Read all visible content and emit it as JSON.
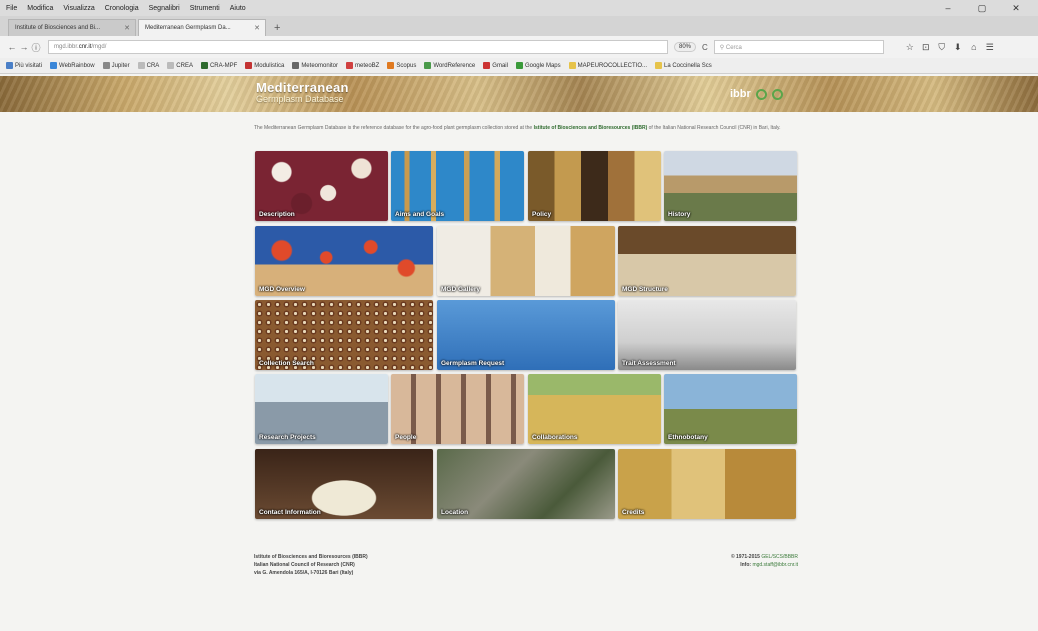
{
  "menu": {
    "items": [
      "File",
      "Modifica",
      "Visualizza",
      "Cronologia",
      "Segnalibri",
      "Strumenti",
      "Aiuto"
    ]
  },
  "window_controls": [
    "–",
    "▢",
    "✕"
  ],
  "tabs": [
    {
      "label": "Institute of Biosciences and Bi..."
    },
    {
      "label": "Mediterranean Germplasm Da..."
    }
  ],
  "newtab_label": "+",
  "nav": {
    "back": "←",
    "forward": "→",
    "info": "ⓘ",
    "url_prefix": "mgd.ibbr.",
    "url_domain": "cnr.it",
    "url_suffix": "/mgd/",
    "zoom": "80%",
    "reload": "C",
    "search_placeholder": "Cerca"
  },
  "toolbar_icons": [
    "☆",
    "⊡",
    "⛉",
    "⬇",
    "⌂",
    "☰"
  ],
  "bookmarks": [
    {
      "label": "Più visitati",
      "color": "#4a7fc7"
    },
    {
      "label": "WebRainbow",
      "color": "#3a86d8"
    },
    {
      "label": "Jupiter",
      "color": "#888888"
    },
    {
      "label": "CRA",
      "color": "#bbbbbb"
    },
    {
      "label": "CREA",
      "color": "#bbbbbb"
    },
    {
      "label": "CRA-MPF",
      "color": "#2f6b2f"
    },
    {
      "label": "Modulistica",
      "color": "#c33333"
    },
    {
      "label": "Meteomonitor",
      "color": "#666666"
    },
    {
      "label": "meteoBZ",
      "color": "#d04040"
    },
    {
      "label": "Scopus",
      "color": "#e07a20"
    },
    {
      "label": "WordReference",
      "color": "#4a9a4a"
    },
    {
      "label": "Gmail",
      "color": "#cc3333"
    },
    {
      "label": "Google Maps",
      "color": "#3a9a3a"
    },
    {
      "label": "MAPEUROCOLLECTIO...",
      "color": "#e6c34a"
    },
    {
      "label": "La Coccinella Scs",
      "color": "#e6c34a"
    }
  ],
  "site": {
    "logo_line1": "Mediterranean",
    "logo_line2": "Germplasm Database",
    "institute_logo": "ibbr",
    "intro_text": "The Mediterranean Germplasm Database is the reference database for the agro-food plant germplasm collection stored at the",
    "intro_link": "Istitute of Biosciences and Bioresources (IBBR)",
    "intro_text2": "of the Italian National Research Council (CNR) in Bari, Italy.",
    "tiles": [
      {
        "label": "Description",
        "bg": "radial-gradient(circle at 20% 30%, #f3ece4 0 8%, transparent 9%), radial-gradient(circle at 55% 60%, #f0e6dc 0 9%, transparent 10%), radial-gradient(circle at 80% 25%, #efe3d6 0 8%, transparent 9%), radial-gradient(circle at 35% 75%, #6b1f2c 0 10%, transparent 11%), #7a2433"
      },
      {
        "label": "Aims and Goals",
        "bg": "linear-gradient(90deg, #2e88c9 0 10%, #c99a4c 10% 14%, #2e88c9 14% 30%, #d6ad5e 30% 34%, #2e88c9 34% 55%, #caa055 55% 59%, #2e88c9 59% 78%, #d3a95a 78% 82%, #2e88c9 82%)"
      },
      {
        "label": "Policy",
        "bg": "linear-gradient(90deg, #7a5a2a 0 20%, #c39a4f 20% 40%, #3d2a1a 40% 60%, #a0713a 60% 80%, #e0c27a 80%)"
      },
      {
        "label": "History",
        "bg": "linear-gradient(180deg, #cfd8e3 0 35%, #b89a6a 35% 60%, #6a7a4a 60%)"
      },
      {
        "label": "MGD Overview",
        "bg": "radial-gradient(circle at 15% 35%, #e04a2a 0 6%, transparent 7%), radial-gradient(circle at 40% 45%, #e04a2a 0 5%, transparent 6%), radial-gradient(circle at 65% 30%, #e04a2a 0 5%, transparent 6%), radial-gradient(circle at 85% 60%, #e04a2a 0 5%, transparent 6%), linear-gradient(180deg, #2c5aa8 0 55%, #d7b07a 55%)"
      },
      {
        "label": "MGD Gallery",
        "bg": "linear-gradient(90deg, #f0ece4 0 30%, #d5b277 30% 55%, #efe9dc 55% 75%, #cfa560 75%)"
      },
      {
        "label": "MGD Structure",
        "bg": "linear-gradient(180deg, #6a4a2a 0 40%, #d8c8a8 40% 100%)"
      },
      {
        "label": "Collection Search",
        "bg": "radial-gradient(circle, #e8d8b8 0 25%, #6a3a20 26% 45%, transparent 46%) 0 0 / 9px 9px, #8a5a30"
      },
      {
        "label": "Germplasm Request",
        "bg": "linear-gradient(180deg, #5a9ad8 0%, #2f6fb8 100%)"
      },
      {
        "label": "Trait Assessment",
        "bg": "linear-gradient(180deg, #e8e8e8 0%, #cfcfcf 60%, #8a8a8a 100%)"
      },
      {
        "label": "Research Projects",
        "bg": "linear-gradient(180deg, #d8e4ec 0 40%, #8a9aa8 40% 100%)"
      },
      {
        "label": "People",
        "bg": "repeating-linear-gradient(90deg, #d8b89a 0 20px, #7a5a4a 20px 25px)"
      },
      {
        "label": "Collaborations",
        "bg": "linear-gradient(180deg, #9ab86a 0 30%, #d6b65a 30% 100%)"
      },
      {
        "label": "Ethnobotany",
        "bg": "linear-gradient(180deg, #8ab4d8 0 50%, #7a8a4a 50% 100%)"
      },
      {
        "label": "Contact Information",
        "bg": "radial-gradient(ellipse at 50% 70%, #efe9d6 0 25%, transparent 26%), linear-gradient(180deg, #3a2418 0%, #6a4a32 100%)"
      },
      {
        "label": "Location",
        "bg": "linear-gradient(135deg, #5a6a4a 0%, #8a8a7a 40%, #4a5a3a 70%, #9a9a8a 100%)"
      },
      {
        "label": "Credits",
        "bg": "linear-gradient(90deg, #c9a24a 0 30%, #e0c27a 30% 60%, #b88a3a 60%)"
      }
    ]
  },
  "footer": {
    "left_line1": "Istitute of Biosciences and Bioresources (IBBR)",
    "left_line2": "Italian National Council of Research (CNR)",
    "left_line3": "via G. Amendola 165/A, I-70126 Bari (Italy)",
    "right_line1": "© 1971-2015",
    "right_line1_link": "GEL/SCS/BBBR",
    "right_line2": "Info:",
    "right_line2_link": "mgd.staff@ibbr.cnr.it"
  }
}
